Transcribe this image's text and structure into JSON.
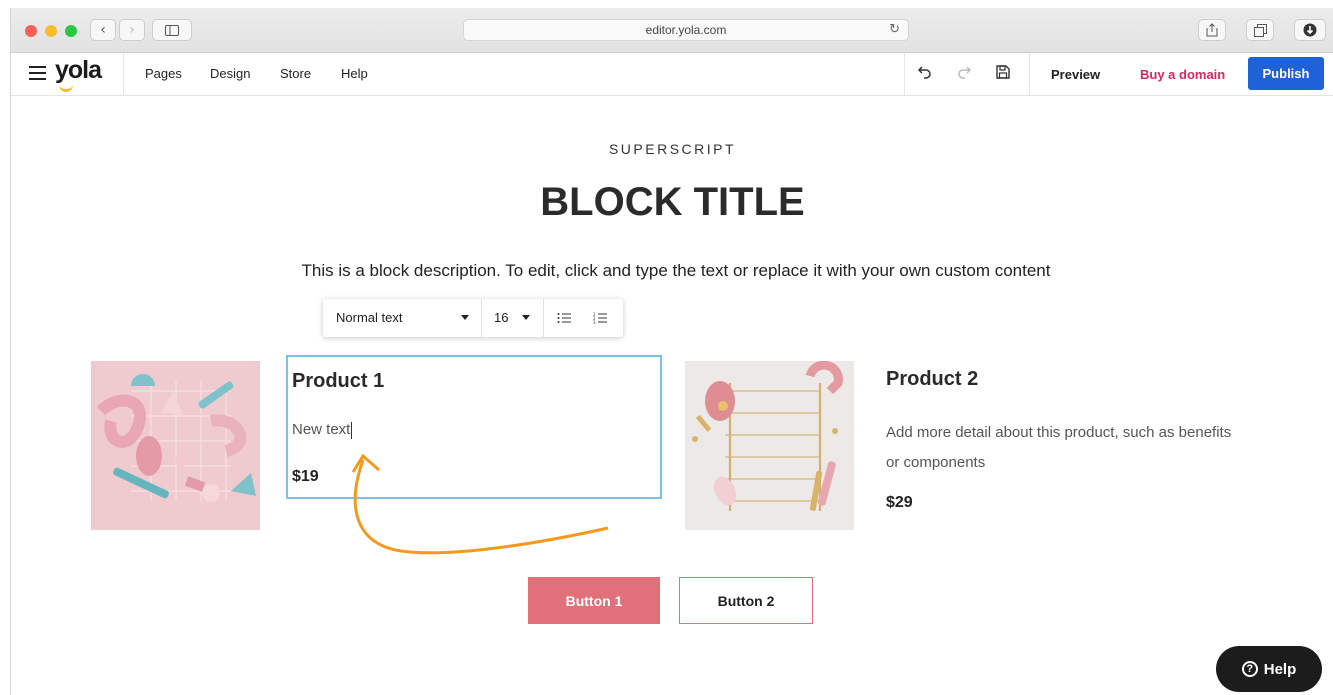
{
  "browser": {
    "url": "editor.yola.com",
    "colors": {
      "close": "#fc5f57",
      "minimize": "#fdbc2e",
      "zoom": "#28c840"
    },
    "icons": [
      "back-icon",
      "forward-icon",
      "sidebar-icon",
      "reload-icon",
      "share-icon",
      "tabs-icon",
      "download-icon"
    ]
  },
  "editor": {
    "logo": "yola",
    "nav": [
      "Pages",
      "Design",
      "Store",
      "Help"
    ],
    "icons": [
      "menu-icon",
      "undo-icon",
      "redo-icon",
      "save-icon"
    ],
    "preview": "Preview",
    "buy_domain": "Buy a domain",
    "publish": "Publish",
    "colors": {
      "publish": "#1f62d8",
      "buy_domain": "#e0245e"
    }
  },
  "block": {
    "superscript": "SUPERSCRIPT",
    "title": "BLOCK TITLE",
    "description": "This is a block description. To edit, click and type the text or replace it with your own custom content"
  },
  "format_toolbar": {
    "style": "Normal text",
    "size": "16",
    "icons": [
      "bulleted-list-icon",
      "numbered-list-icon"
    ]
  },
  "products": [
    {
      "name": "Product 1",
      "text": "New text",
      "price": "$19"
    },
    {
      "name": "Product 2",
      "text": "Add more detail about this product, such as benefits or components",
      "price": "$29"
    }
  ],
  "buttons": {
    "button1": "Button 1",
    "button2": "Button 2",
    "colors": {
      "button1": "#e0707a"
    }
  },
  "help": {
    "label": "Help"
  }
}
